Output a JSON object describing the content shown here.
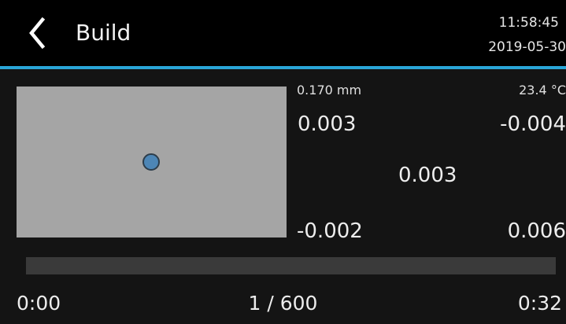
{
  "header": {
    "title": "Build",
    "time": "11:58:45",
    "date": "2019-05-30",
    "back_icon": "chevron-left-icon",
    "accent_color": "#2aa6d8"
  },
  "readouts": {
    "layer_height": "0.170 mm",
    "temperature": "23.4 °C",
    "top_left": "0.003",
    "top_right": "-0.004",
    "center": "0.003",
    "bottom_left": "-0.002",
    "bottom_right": "0.006"
  },
  "leveling": {
    "panel_color": "#a5a5a5",
    "dot_color": "#4d86b6"
  },
  "progress": {
    "fraction": 0.0,
    "elapsed": "0:00",
    "layers": "1 / 600",
    "remaining": "0:32"
  }
}
